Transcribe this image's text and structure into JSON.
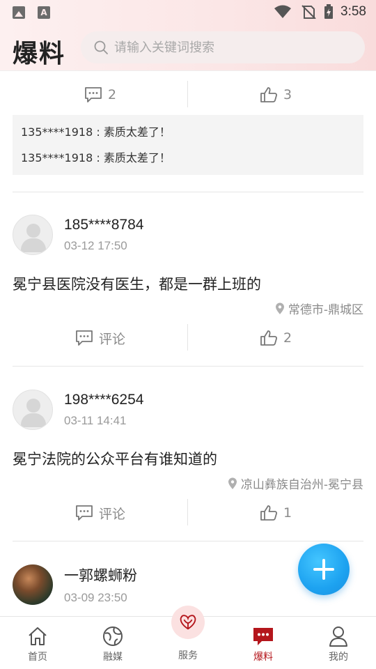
{
  "status_bar": {
    "time": "3:58"
  },
  "header": {
    "brand": "爆料",
    "search_placeholder": "请输入关键词搜索"
  },
  "first_post": {
    "comment_count": "2",
    "like_count": "3",
    "comments": [
      "135****1918 : 素质太差了！",
      "135****1918 : 素质太差了！"
    ]
  },
  "posts": [
    {
      "user": "185****8784",
      "time": "03-12 17:50",
      "text": "冕宁县医院没有医生，都是一群上班的",
      "location": "常德市-鼎城区",
      "comment_label": "评论",
      "like_count": "2"
    },
    {
      "user": "198****6254",
      "time": "03-11 14:41",
      "text": "冕宁法院的公众平台有谁知道的",
      "location": "凉山彝族自治州-冕宁县",
      "comment_label": "评论",
      "like_count": "1"
    },
    {
      "user": "一郭螺蛳粉",
      "time": "03-09 23:50"
    }
  ],
  "tabbar": {
    "items": [
      {
        "label": "首页",
        "icon": "home-icon"
      },
      {
        "label": "融媒",
        "icon": "globe-icon"
      },
      {
        "label": "服务",
        "icon": "heart-hands-icon"
      },
      {
        "label": "爆料",
        "icon": "chat-dots-icon",
        "active": true
      },
      {
        "label": "我的",
        "icon": "person-icon"
      }
    ]
  },
  "colors": {
    "accent": "#b4161c",
    "fab": "#1da2f0"
  }
}
